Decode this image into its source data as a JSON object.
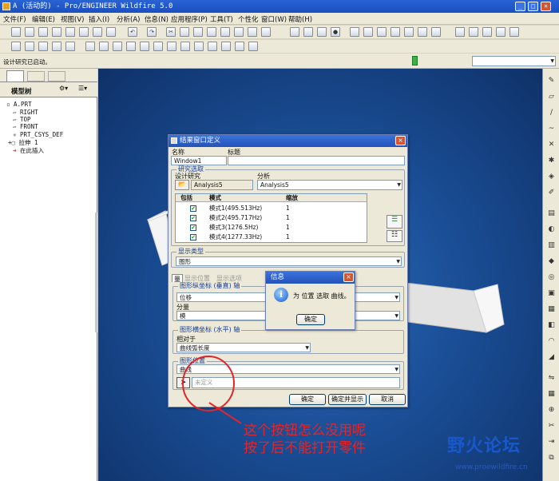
{
  "window": {
    "title": "A (活动的) - Pro/ENGINEER Wildfire 5.0"
  },
  "menu": [
    "文件(F)",
    "编辑(E)",
    "视图(V)",
    "插入(I)",
    "分析(A)",
    "信息(N)",
    "应用程序(P)",
    "工具(T)",
    "个性化",
    "窗口(W)",
    "帮助(H)"
  ],
  "message": "设计研究已启动。",
  "left_panel": {
    "title": "模型树",
    "tree": [
      "A.PRT",
      "RIGHT",
      "TOP",
      "FRONT",
      "PRT_CSYS_DEF",
      "拉伸 1",
      "在此插入"
    ]
  },
  "dialog": {
    "title": "结果窗口定义",
    "name_label": "名称",
    "name_value": "Window1",
    "title_label": "标题",
    "study_group": "研究选取",
    "design_study_label": "设计研究",
    "design_study_value": "Analysis5",
    "analysis_label": "分析",
    "analysis_value": "Analysis5",
    "table": {
      "headers": [
        "包括",
        "模式",
        "缩放"
      ],
      "rows": [
        [
          "模式1(495.513Hz)",
          "1"
        ],
        [
          "模式2(495.717Hz)",
          "1"
        ],
        [
          "模式3(1276.5Hz)",
          "1"
        ],
        [
          "模式4(1277.33Hz)",
          "1"
        ]
      ]
    },
    "display_type_group": "显示类型",
    "display_type_value": "图形",
    "tabs": [
      "量",
      "显示位置",
      "显示选项"
    ],
    "y_axis_group": "图形纵坐标 (垂直) 轴",
    "y_value": "位移",
    "component_label": "分量",
    "component_value": "模",
    "x_axis_group": "图形横坐标 (水平) 轴",
    "relative_label": "相对于",
    "relative_value": "曲线弧长度",
    "location_group": "图形位置",
    "location_value": "曲线",
    "undefined_text": "未定义",
    "buttons": {
      "ok": "确定",
      "ok_show": "确定并显示",
      "cancel": "取消"
    }
  },
  "info_dialog": {
    "title": "信息",
    "message": "为 位置 选取 曲线。",
    "ok": "确定"
  },
  "annotation": [
    "这个按钮怎么没用呢",
    "按了后不能打开零件"
  ],
  "watermark": {
    "logo": "野火论坛",
    "url": "www.proewildfire.cn"
  }
}
